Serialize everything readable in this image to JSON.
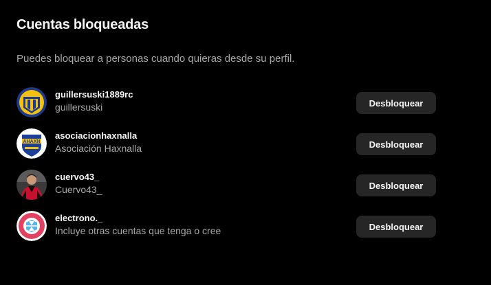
{
  "page": {
    "title": "Cuentas bloqueadas",
    "description": "Puedes bloquear a personas cuando quieras desde su perfil."
  },
  "accounts": [
    {
      "username": "guillersuski1889rc",
      "fullname": "guillersuski",
      "button_label": "Desbloquear",
      "avatar_icon": "rosario-central-crest-icon"
    },
    {
      "username": "asociacionhaxnalla",
      "fullname": "Asociación Haxnalla",
      "button_label": "Desbloquear",
      "avatar_icon": "ahaxn-crest-icon",
      "avatar_text": "AHAXN"
    },
    {
      "username": "cuervo43_",
      "fullname": "Cuervo43_",
      "button_label": "Desbloquear",
      "avatar_icon": "player-photo-icon"
    },
    {
      "username": "electrono._",
      "fullname": "Incluye otras cuentas que tenga o cree",
      "button_label": "Desbloquear",
      "avatar_icon": "bayern-crest-icon"
    }
  ],
  "colors": {
    "background": "#000000",
    "primary_text": "#f5f5f5",
    "secondary_text": "#a8a8a8",
    "button_bg": "#262626"
  }
}
